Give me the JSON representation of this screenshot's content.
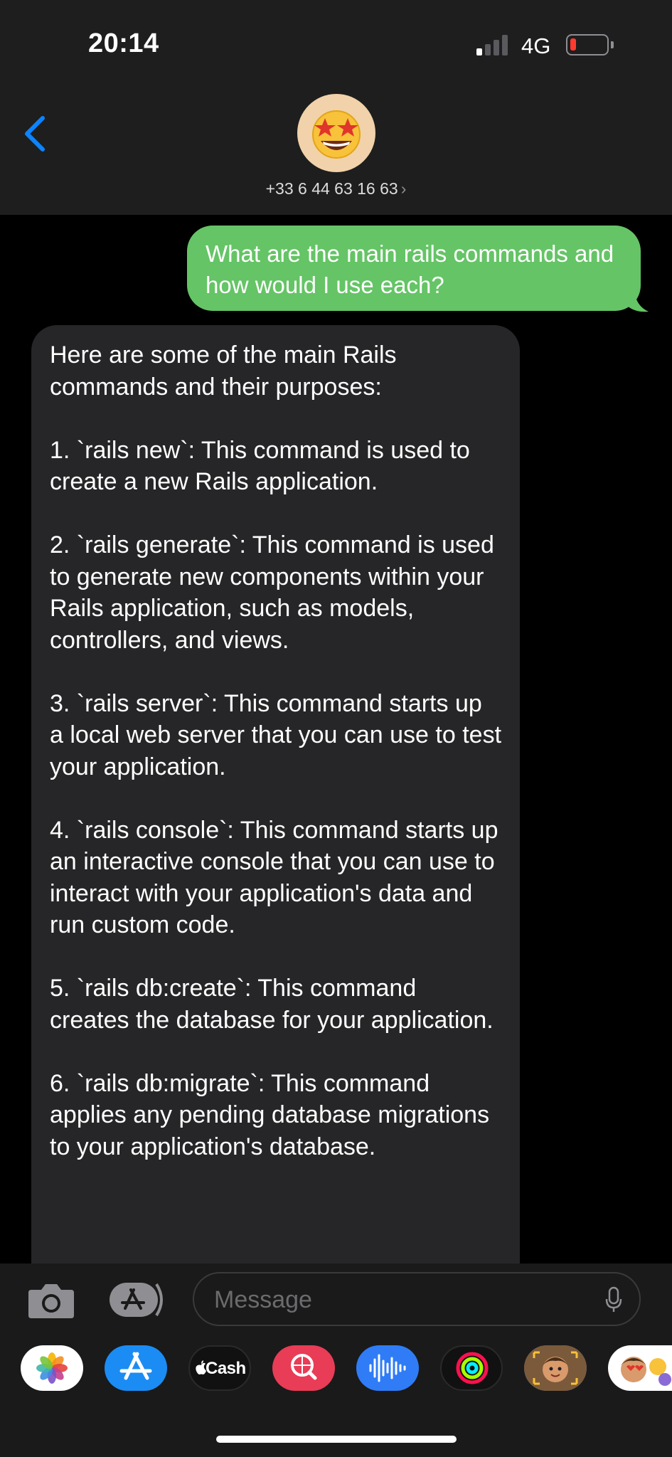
{
  "status_bar": {
    "time": "20:14",
    "network": "4G",
    "signal_bars_active": 1,
    "signal_bars_total": 4,
    "battery_level": "low",
    "battery_color": "#ff3b30"
  },
  "header": {
    "contact_number": "+33 6 44 63 16 63",
    "chevron": "›",
    "avatar_icon": "star-struck-emoji-icon",
    "back_icon": "chevron-left-icon"
  },
  "messages": [
    {
      "direction": "sent",
      "text": "What are the main rails commands and how would I use each?",
      "bubble_color": "#65c466"
    },
    {
      "direction": "received",
      "text": "Here are some of the main Rails commands and their purposes:\n\n1. `rails new`: This command is used to create a new Rails application.\n\n2. `rails generate`: This command is used to generate new components within your Rails application, such as models, controllers, and views.\n\n3. `rails server`: This command starts up a local web server that you can use to test your application.\n\n4. `rails console`: This command starts up an interactive console that you can use to interact with your application's data and run custom code.\n\n5. `rails db:create`: This command creates the database for your application.\n\n6. `rails db:migrate`: This command applies any pending database migrations to your application's database.",
      "bubble_color": "#262628"
    }
  ],
  "input_bar": {
    "placeholder": "Message",
    "camera_icon": "camera-icon",
    "apps_icon": "app-store-icon",
    "mic_icon": "microphone-icon"
  },
  "app_drawer": {
    "apps": [
      {
        "name": "Photos",
        "icon": "photos-icon"
      },
      {
        "name": "App Store",
        "icon": "app-store-icon"
      },
      {
        "name": "Apple Cash",
        "icon": "apple-cash-icon",
        "label": "Cash"
      },
      {
        "name": "Search",
        "icon": "image-search-icon"
      },
      {
        "name": "Audio",
        "icon": "audio-waveform-icon"
      },
      {
        "name": "Fitness",
        "icon": "activity-rings-icon"
      },
      {
        "name": "Memoji",
        "icon": "memoji-icon"
      },
      {
        "name": "Memoji Stickers",
        "icon": "memoji-stickers-icon"
      }
    ]
  }
}
